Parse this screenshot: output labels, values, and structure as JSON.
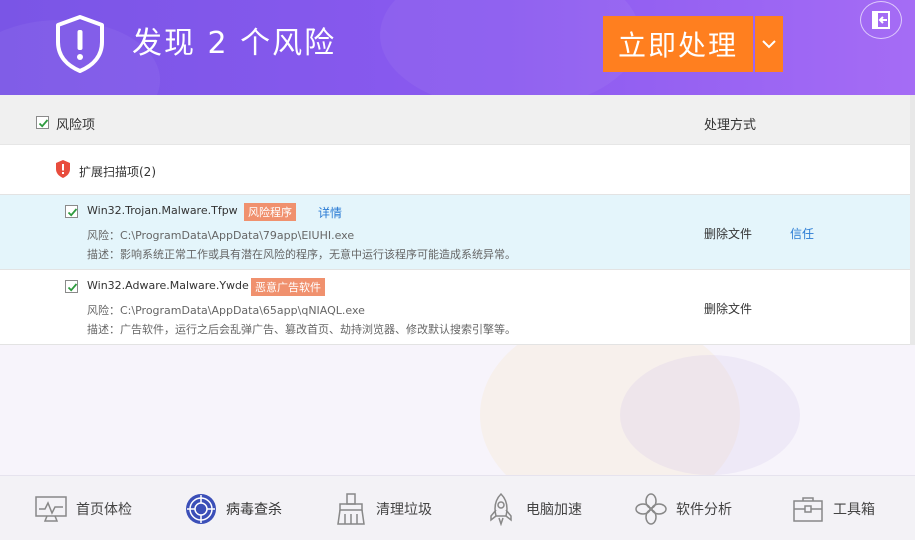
{
  "header": {
    "title": "发现 2 个风险",
    "primary_action": "立即处理",
    "icons": {
      "shield": "shield-warning-icon",
      "dropdown": "chevron-down-icon",
      "exit": "exit-icon"
    }
  },
  "columns": {
    "risk_item": "风险项",
    "handling": "处理方式"
  },
  "group": {
    "label": "扩展扫描项(2)"
  },
  "items": [
    {
      "name": "Win32.Trojan.Malware.Tfpw",
      "tag": "风险程序",
      "detail": "详情",
      "path": "风险：C:\\ProgramData\\AppData\\79app\\EIUHI.exe",
      "desc": "描述：影响系统正常工作或具有潜在风险的程序，无意中运行该程序可能造成系统异常。",
      "action": "删除文件",
      "trust": "信任"
    },
    {
      "name": "Win32.Adware.Malware.Ywde",
      "tag": "恶意广告软件",
      "path": "风险：C:\\ProgramData\\AppData\\65app\\qNIAQL.exe",
      "desc": "描述：广告软件，运行之后会乱弹广告、篡改首页、劫持浏览器、修改默认搜索引擎等。",
      "action": "删除文件"
    }
  ],
  "nav": [
    {
      "label": "首页体检",
      "icon": "monitor-icon"
    },
    {
      "label": "病毒查杀",
      "icon": "virus-scan-icon",
      "active": true
    },
    {
      "label": "清理垃圾",
      "icon": "broom-icon"
    },
    {
      "label": "电脑加速",
      "icon": "rocket-icon"
    },
    {
      "label": "软件分析",
      "icon": "clover-icon"
    },
    {
      "label": "工具箱",
      "icon": "toolbox-icon"
    }
  ],
  "colors": {
    "header_start": "#7a55e6",
    "header_end": "#a56cf5",
    "primary_button": "#ff7f1f",
    "tag": "#f0916e",
    "link": "#2a7bd4",
    "selected_row": "#e4f5fb",
    "warning_red": "#e84c3d"
  }
}
